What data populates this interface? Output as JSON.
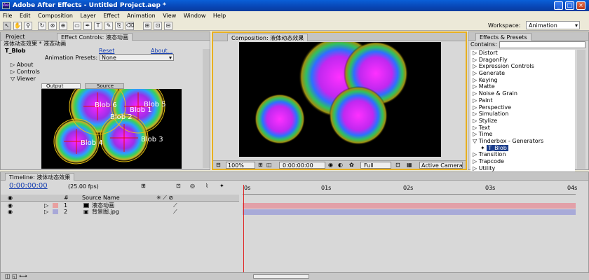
{
  "window": {
    "title": "Adobe After Effects - Untitled Project.aep *",
    "app_icon": "Ae"
  },
  "menu": [
    "File",
    "Edit",
    "Composition",
    "Layer",
    "Effect",
    "Animation",
    "View",
    "Window",
    "Help"
  ],
  "toolbar": {
    "workspace_label": "Workspace:",
    "workspace_value": "Animation"
  },
  "left_panel": {
    "tabs": [
      "Project",
      "Effect Controls: 液态动画"
    ],
    "breadcrumb": "液体动态效果 * 液态动画",
    "effect_name": "T_Blob",
    "reset": "Reset",
    "about": "About...",
    "presets_label": "Animation Presets:",
    "presets_value": "None",
    "props": [
      "About",
      "Controls",
      "Viewer"
    ],
    "viewer_tabs": [
      "Output",
      "Source"
    ],
    "blobs": [
      "Blob 6",
      "Blob 5",
      "Blob 1",
      "Blob 2",
      "Blob 3",
      "Blob 4"
    ]
  },
  "comp_panel": {
    "tab": "Composition: 液体动态效果",
    "zoom": "100%",
    "timecode": "0:00:00:00",
    "resolution": "Full",
    "camera": "Active Camera"
  },
  "effects_panel": {
    "tab": "Effects & Presets",
    "contains_label": "Contains:",
    "items": [
      "Distort",
      "DragonFly",
      "Expression Controls",
      "Generate",
      "Keying",
      "Matte",
      "Noise & Grain",
      "Paint",
      "Perspective",
      "Simulation",
      "Stylize",
      "Text",
      "Time",
      "Tinderbox - Generators",
      "T_Blob",
      "Transition",
      "Trapcode",
      "Utility"
    ]
  },
  "timeline": {
    "tab": "Timeline: 液体动态效果",
    "timecode": "0:00:00:00",
    "fps": "(25.00 fps)",
    "col_num": "#",
    "col_source": "Source Name",
    "ruler": [
      "0s",
      "01s",
      "02s",
      "03s",
      "04s"
    ],
    "layers": [
      {
        "num": "1",
        "name": "液态动画",
        "color": "#e8a0a0"
      },
      {
        "num": "2",
        "name": "背景图.jpg",
        "color": "#a8a8d8"
      }
    ]
  }
}
